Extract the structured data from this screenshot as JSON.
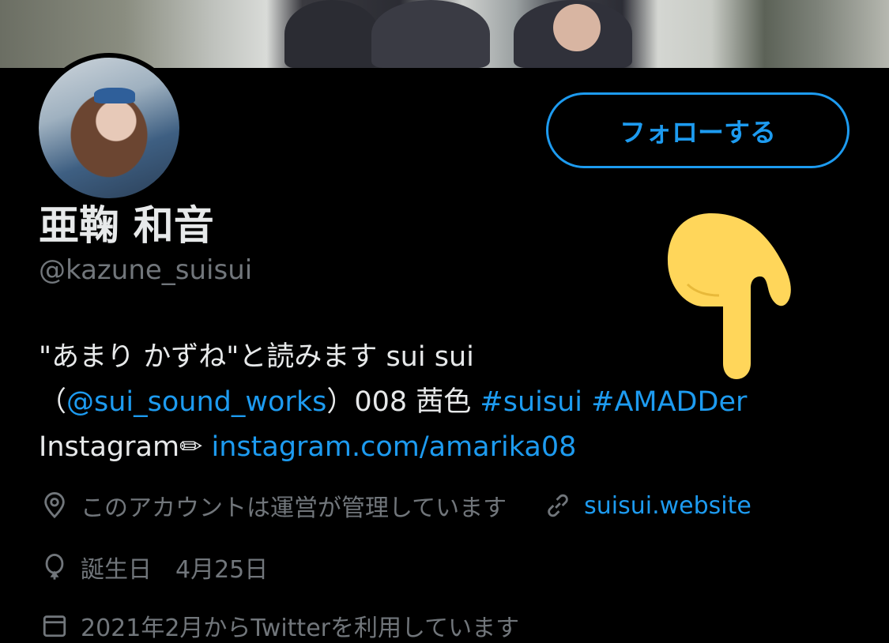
{
  "profile": {
    "display_name": "亜鞠 和音",
    "handle": "@kazune_suisui",
    "follow_label": "フォローする"
  },
  "bio": {
    "line1": "\"あまり かずね\"と読みます sui sui",
    "line2_open": "（",
    "line2_mention": "@sui_sound_works",
    "line2_mid": "）008 茜色 ",
    "line2_tag1": "#suisui",
    "line2_tag2": "#AMADDer",
    "line3_prefix": "Instagram✏ ",
    "line3_link": "instagram.com/amarika08"
  },
  "meta": {
    "location": "このアカウントは運営が管理しています",
    "website": "suisui.website",
    "birthday": "誕生日　4月25日",
    "joined": "2021年2月からTwitterを利用しています"
  },
  "icons": {
    "location": "location-pin-icon",
    "website": "link-icon",
    "birthday": "balloon-icon",
    "joined": "calendar-icon",
    "pointer": "pointing-down-hand-emoji"
  },
  "colors": {
    "accent": "#1d9bf0",
    "background": "#000000",
    "secondary_text": "#71767b",
    "hand": "#ffd65a"
  }
}
